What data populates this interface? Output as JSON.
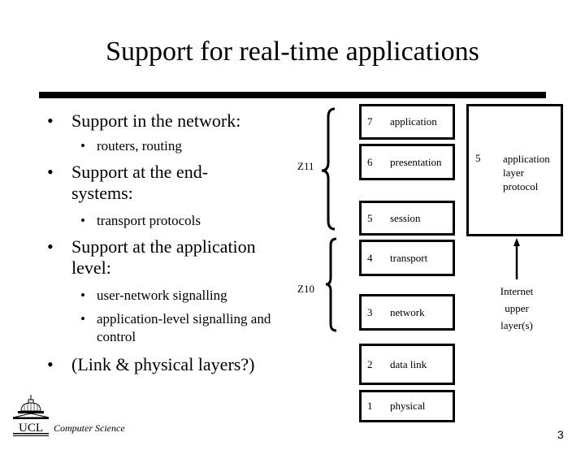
{
  "slide": {
    "title": "Support for real-time applications",
    "page_number": "3",
    "footer": {
      "institution_logo": "UCL",
      "department": "Computer Science"
    }
  },
  "bullets": [
    {
      "level": 1,
      "text": "Support in the network:"
    },
    {
      "level": 2,
      "text": "routers, routing"
    },
    {
      "level": 1,
      "text": "Support at the end-systems:"
    },
    {
      "level": 2,
      "text": "transport protocols"
    },
    {
      "level": 1,
      "text": "Support at the application level:"
    },
    {
      "level": 2,
      "text": "user-network signalling"
    },
    {
      "level": 2,
      "text": "application-level signalling and control"
    },
    {
      "level": 1,
      "text": "(Link & physical layers?)"
    }
  ],
  "diagram": {
    "layers": [
      {
        "num": "7",
        "name": "application"
      },
      {
        "num": "6",
        "name": "presentation"
      },
      {
        "num": "5",
        "name": "session"
      },
      {
        "num": "4",
        "name": "transport"
      },
      {
        "num": "3",
        "name": "network"
      },
      {
        "num": "2",
        "name": "data link"
      },
      {
        "num": "1",
        "name": "physical"
      }
    ],
    "groups": [
      {
        "label": "Z11",
        "spans": [
          "7",
          "6",
          "5"
        ]
      },
      {
        "label": "Z10",
        "spans": [
          "4",
          "3"
        ]
      }
    ],
    "app_protocol_box": {
      "num": "5",
      "line1": "application",
      "line2": "layer",
      "line3": "protocol"
    },
    "internet_label": {
      "line1": "Internet",
      "line2": "upper",
      "line3": "layer(s)"
    }
  }
}
